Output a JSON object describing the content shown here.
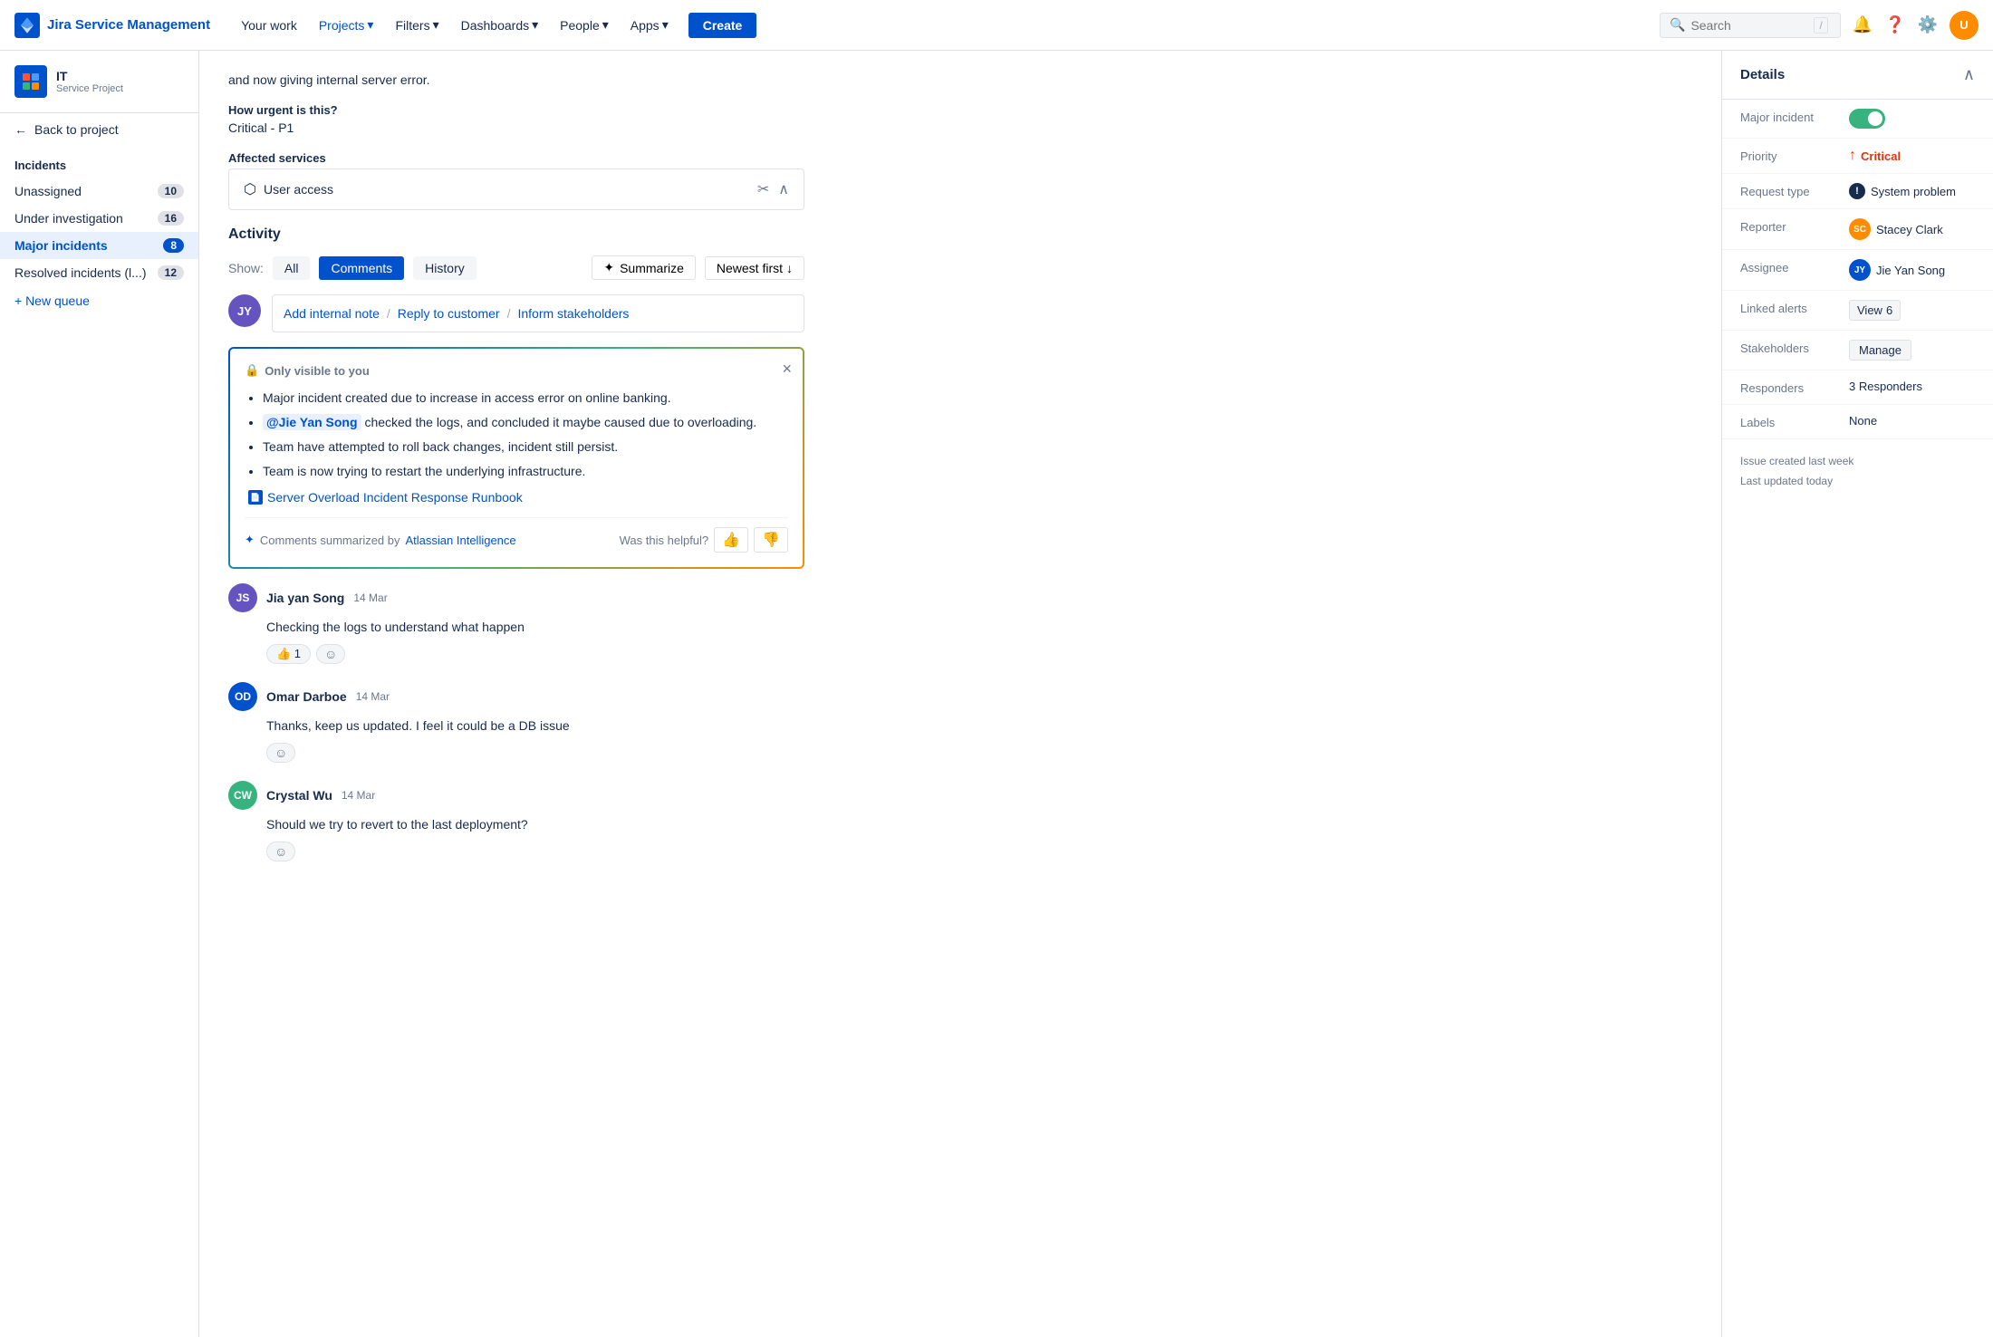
{
  "topnav": {
    "logo_text": "Jira Service Management",
    "links": [
      "Your work",
      "Projects",
      "Filters",
      "Dashboards",
      "People",
      "Apps"
    ],
    "create_label": "Create",
    "search_placeholder": "Search",
    "search_shortcut": "/"
  },
  "sidebar": {
    "project_name": "IT",
    "project_type": "Service Project",
    "back_label": "Back to project",
    "section_title": "Incidents",
    "items": [
      {
        "label": "Unassigned",
        "count": "10",
        "active": false
      },
      {
        "label": "Under investigation",
        "count": "16",
        "active": false
      },
      {
        "label": "Major incidents",
        "count": "8",
        "active": true
      },
      {
        "label": "Resolved incidents (l...)",
        "count": "12",
        "active": false
      }
    ],
    "add_queue": "+ New queue"
  },
  "ticket": {
    "description_partial": "and now giving internal server error.",
    "urgency_label": "How urgent is this?",
    "urgency_value": "Critical - P1",
    "affected_label": "Affected services",
    "affected_service": "User access"
  },
  "activity": {
    "title": "Activity",
    "show_label": "Show:",
    "filters": [
      "All",
      "Comments",
      "History"
    ],
    "active_filter": "Comments",
    "summarize_label": "Summarize",
    "newest_label": "Newest first",
    "add_internal": "Add internal note",
    "reply_customer": "Reply to customer",
    "inform_stakeholders": "Inform stakeholders",
    "summary_box": {
      "visibility_note": "Only visible to you",
      "items": [
        "Major incident created due to increase in access error on online banking.",
        "@Jie Yan Song checked the logs, and concluded it maybe caused due to overloading.",
        "Team have attempted to roll back changes, incident still persist.",
        "Team is now trying to restart the underlying infrastructure."
      ],
      "doc_link": "Server Overload Incident Response Runbook",
      "ai_credit": "Comments summarized by",
      "ai_link": "Atlassian Intelligence",
      "helpful_label": "Was this helpful?"
    },
    "comments": [
      {
        "user": "Jia yan Song",
        "avatar_bg": "#6554c0",
        "initials": "JS",
        "date": "14 Mar",
        "content": "Checking the logs to understand what happen",
        "reactions": [
          {
            "emoji": "👍",
            "count": "1"
          }
        ],
        "has_emoji_add": true
      },
      {
        "user": "Omar Darboe",
        "avatar_bg": "#0052cc",
        "initials": "OD",
        "date": "14 Mar",
        "content": "Thanks, keep us updated. I feel it could be a DB issue",
        "reactions": [],
        "has_emoji_add": true
      },
      {
        "user": "Crystal Wu",
        "avatar_bg": "#36b37e",
        "initials": "CW",
        "date": "14 Mar",
        "content": "Should we try to revert to the last deployment?",
        "reactions": [],
        "has_emoji_add": true
      }
    ]
  },
  "details": {
    "title": "Details",
    "rows": [
      {
        "label": "Major incident",
        "type": "toggle",
        "value": true
      },
      {
        "label": "Priority",
        "type": "priority",
        "value": "Critical"
      },
      {
        "label": "Request type",
        "type": "reqtype",
        "value": "System problem"
      },
      {
        "label": "Reporter",
        "type": "user",
        "name": "Stacey Clark",
        "avatar_bg": "#ff8b00",
        "initials": "SC"
      },
      {
        "label": "Assignee",
        "type": "user",
        "name": "Jie Yan Song",
        "avatar_bg": "#0052cc",
        "initials": "JY"
      },
      {
        "label": "Linked alerts",
        "type": "view_badge",
        "view": "View",
        "count": "6"
      },
      {
        "label": "Stakeholders",
        "type": "badge_btn",
        "value": "Manage"
      },
      {
        "label": "Responders",
        "type": "text",
        "value": "3 Responders"
      },
      {
        "label": "Labels",
        "type": "text",
        "value": "None"
      }
    ],
    "meta_created": "Issue created last week",
    "meta_updated": "Last updated today"
  }
}
